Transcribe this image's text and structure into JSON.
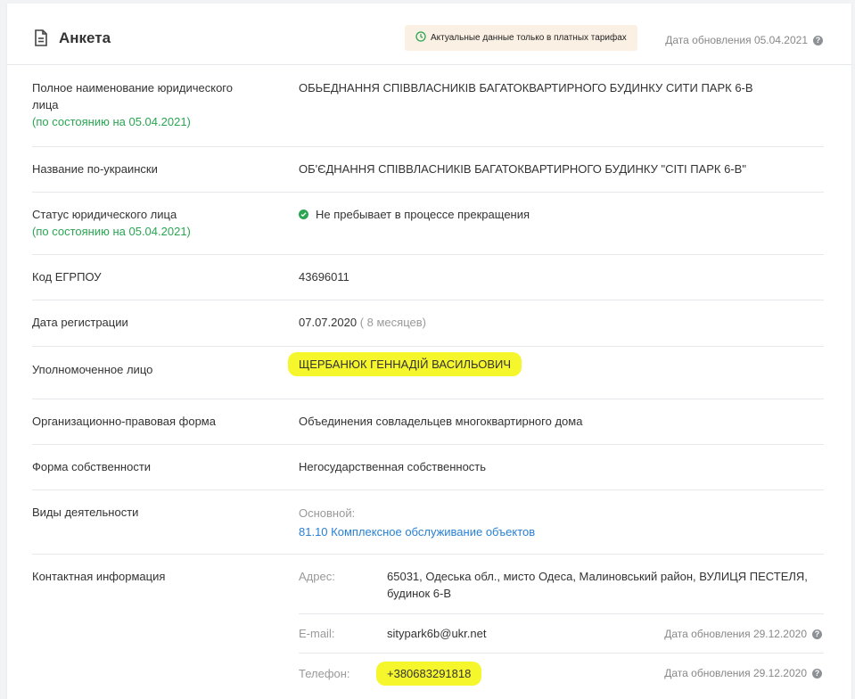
{
  "header": {
    "title": "Анкета",
    "badge_text": "Актуальные данные только в платных тарифах",
    "update_date": "Дата обновления 05.04.2021"
  },
  "fields": {
    "full_name": {
      "label": "Полное наименование юридического лица",
      "note": "(по состоянию на 05.04.2021)",
      "value": "ОБЬЕДНАННЯ СПІВВЛАСНИКІВ БАГАТОКВАРТИРНОГО БУДИНКУ СИТИ ПАРК 6-В"
    },
    "ukr_name": {
      "label": "Название по-украински",
      "value": "ОБ'ЄДНАННЯ СПІВВЛАСНИКІВ БАГАТОКВАРТИРНОГО БУДИНКУ \"СІТІ ПАРК 6-В\""
    },
    "status": {
      "label": "Статус юридического лица",
      "note": "(по состоянию на 05.04.2021)",
      "value": "Не пребывает в процессе прекращения"
    },
    "edrpou": {
      "label": "Код ЕГРПОУ",
      "value": "43696011"
    },
    "reg_date": {
      "label": "Дата регистрации",
      "value": "07.07.2020",
      "age": "( 8 месяцев)"
    },
    "authorized": {
      "label": "Уполномоченное лицо",
      "value": "ЩЕРБАНЮК ГЕННАДІЙ ВАСИЛЬОВИЧ"
    },
    "legal_form": {
      "label": "Организационно-правовая форма",
      "value": "Объединения совладельцев многоквартирного дома"
    },
    "ownership": {
      "label": "Форма собственности",
      "value": "Негосударственная собственность"
    },
    "activities": {
      "label": "Виды деятельности",
      "main_label": "Основной:",
      "main_value": "81.10 Комплексное обслуживание объектов"
    },
    "contacts": {
      "label": "Контактная информация",
      "address_label": "Адрес:",
      "address_value": "65031, Одеська обл., мисто Одеса, Малиновський район, ВУЛИЦЯ ПЕСТЕЛЯ, будинок 6-В",
      "email_label": "E-mail:",
      "email_value": "sitypark6b@ukr.net",
      "email_date": "Дата обновления 29.12.2020",
      "phone_label": "Телефон:",
      "phone_value": "+380683291818",
      "phone_date": "Дата обновления 29.12.2020"
    }
  },
  "help_glyph": "?",
  "colors": {
    "accent_green": "#2aa552",
    "link_blue": "#2980d4",
    "highlight": "#f6f62d",
    "badge_bg": "#fbf0e4"
  }
}
